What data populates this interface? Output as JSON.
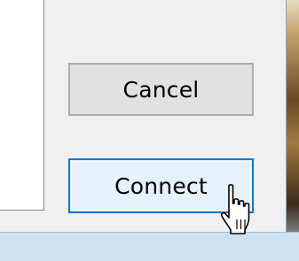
{
  "dialog": {
    "buttons": {
      "cancel_label": "Cancel",
      "connect_label": "Connect"
    }
  },
  "colors": {
    "dialog_background": "#f0f0f0",
    "default_button_border": "#0078d7",
    "default_button_fill": "#e5f1fb",
    "button_fill": "#e1e1e1",
    "button_border": "#adadad"
  },
  "icons": {
    "cursor": "hand-pointer-cursor-icon"
  }
}
